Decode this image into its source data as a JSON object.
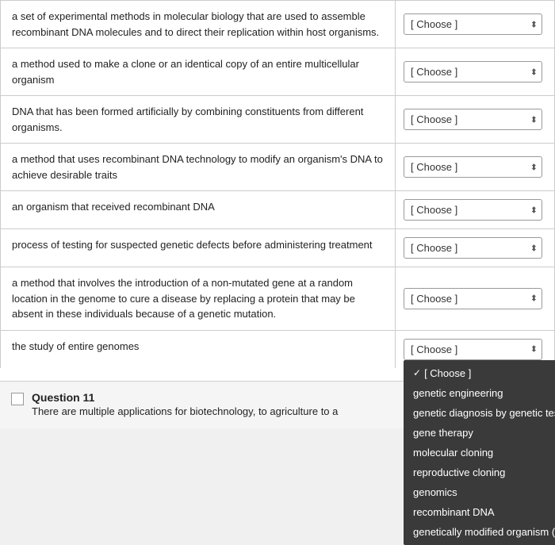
{
  "rows": [
    {
      "id": "row1",
      "text": "a set of experimental methods in molecular biology that are used to assemble recombinant DNA molecules and to direct their replication within host organisms.",
      "selectValue": "Choose"
    },
    {
      "id": "row2",
      "text": "a method used to make a clone or an identical copy of an entire multicellular organism",
      "selectValue": "Choose"
    },
    {
      "id": "row3",
      "text": "DNA that has been formed artificially by combining constituents from different organisms.",
      "selectValue": "Choose"
    },
    {
      "id": "row4",
      "text": "a method that uses recombinant DNA technology to modify an organism's DNA to achieve desirable traits",
      "selectValue": "Choose"
    },
    {
      "id": "row5",
      "text": "an organism that received recombinant DNA",
      "selectValue": "Choose"
    },
    {
      "id": "row6",
      "text": "process of testing for suspected genetic defects before administering treatment",
      "selectValue": "Choose"
    },
    {
      "id": "row7",
      "text": "a method that involves the introduction of a non-mutated gene at a random location in the genome to cure a disease by replacing a protein that may be absent in these individuals because of a genetic mutation.",
      "selectValue": "Choose"
    },
    {
      "id": "row8",
      "text": "the study of entire genomes",
      "selectValue": "Choose",
      "dropdownOpen": true
    }
  ],
  "dropdown_options": [
    {
      "label": "[ Choose ]",
      "selected": true
    },
    {
      "label": "genetic engineering",
      "selected": false
    },
    {
      "label": "genetic diagnosis by genetic testing",
      "selected": false
    },
    {
      "label": "gene therapy",
      "selected": false
    },
    {
      "label": "molecular cloning",
      "selected": false
    },
    {
      "label": "reproductive cloning",
      "selected": false
    },
    {
      "label": "genomics",
      "selected": false
    },
    {
      "label": "recombinant DNA",
      "selected": false
    },
    {
      "label": "genetically modified organism (GMO)",
      "selected": false
    }
  ],
  "question11": {
    "label": "Question 11",
    "text": "There are multiple applications for biotechnology,",
    "suffix": "to agriculture to a"
  },
  "select_placeholder": "[ Choose ]"
}
